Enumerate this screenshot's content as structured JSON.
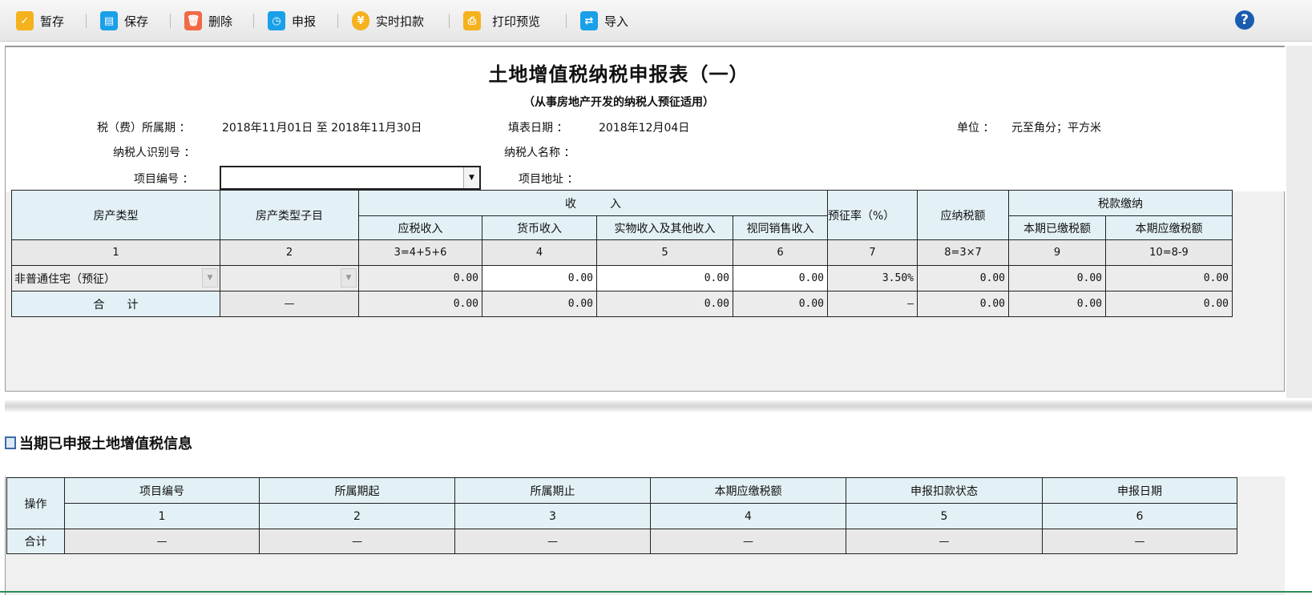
{
  "toolbar": {
    "buttons": [
      {
        "label": "暂存",
        "icon": "clipboard-icon",
        "color": "#f5b21d"
      },
      {
        "label": "保存",
        "icon": "save-icon",
        "color": "#1aa0e8"
      },
      {
        "label": "删除",
        "icon": "trash-icon",
        "color": "#f06a45"
      },
      {
        "label": "申报",
        "icon": "stopwatch-icon",
        "color": "#1aa0e8"
      },
      {
        "label": "实时扣款",
        "icon": "coin-icon",
        "color": "#f5b21d"
      },
      {
        "label": "打印预览",
        "icon": "printer-icon",
        "color": "#f5b21d"
      },
      {
        "label": "导入",
        "icon": "import-icon",
        "color": "#1aa0e8"
      }
    ],
    "help": "?"
  },
  "form": {
    "title": "土地增值税纳税申报表（一）",
    "subtitle": "（从事房地产开发的纳税人预征适用）",
    "period_label": "税（费）所属期 ：",
    "period_value": "2018年11月01日 至 2018年11月30日",
    "fill_date_label": "填表日期 ：",
    "fill_date_value": "2018年12月04日",
    "unit_label": "单位 ：",
    "unit_value": "元至角分；平方米",
    "taxpayer_id_label": "纳税人识别号 ：",
    "taxpayer_name_label": "纳税人名称 ：",
    "project_no_label": "项目编号 ：",
    "project_no_value": "",
    "project_addr_label": "项目地址 ："
  },
  "main_table": {
    "h_type": "房产类型",
    "h_subtype": "房产类型子目",
    "h_income": "收　　　入",
    "h_taxable": "应税收入",
    "h_money": "货币收入",
    "h_kind": "实物收入及其他收入",
    "h_deemed": "视同销售收入",
    "h_rate": "预征率（%）",
    "h_tax": "应纳税额",
    "h_pay": "税款缴纳",
    "h_paid": "本期已缴税额",
    "h_due": "本期应缴税额",
    "nums": [
      "1",
      "2",
      "3=4+5+6",
      "4",
      "5",
      "6",
      "7",
      "8=3×7",
      "9",
      "10=8-9"
    ],
    "row": {
      "type": "非普通住宅（预征）",
      "subtype": "",
      "c3": "0.00",
      "c4": "0.00",
      "c5": "0.00",
      "c6": "0.00",
      "c7": "3.50%",
      "c8": "0.00",
      "c9": "0.00",
      "c10": "0.00"
    },
    "total": {
      "label": "合　　计",
      "c2": "—",
      "c3": "0.00",
      "c4": "0.00",
      "c5": "0.00",
      "c6": "0.00",
      "c7": "—",
      "c8": "0.00",
      "c9": "0.00",
      "c10": "0.00"
    }
  },
  "history": {
    "title": "当期已申报土地增值税信息",
    "headers": [
      "操作",
      "项目编号",
      "所属期起",
      "所属期止",
      "本期应缴税额",
      "申报扣款状态",
      "申报日期"
    ],
    "nums": [
      "1",
      "2",
      "3",
      "4",
      "5",
      "6"
    ],
    "total": [
      "合计",
      "—",
      "—",
      "—",
      "—",
      "—",
      "—"
    ]
  }
}
